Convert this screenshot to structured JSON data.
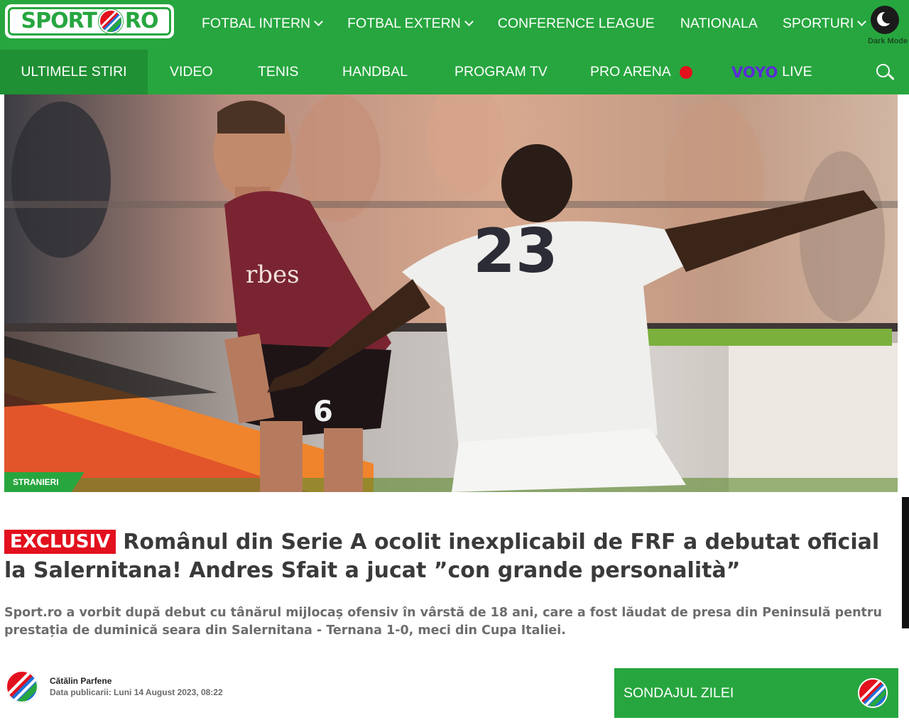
{
  "brand": {
    "logo_left": "SPORT",
    "logo_right": "RO",
    "colors": {
      "green": "#27a63f",
      "red": "#e3101d",
      "blue": "#1e6fd9",
      "voyo_purple": "#5b2bd8"
    }
  },
  "top_nav": {
    "items": [
      {
        "label": "FOTBAL INTERN",
        "dropdown": true
      },
      {
        "label": "FOTBAL EXTERN",
        "dropdown": true
      },
      {
        "label": "CONFERENCE LEAGUE",
        "dropdown": false
      },
      {
        "label": "NATIONALA",
        "dropdown": false
      },
      {
        "label": "SPORTURI",
        "dropdown": true
      }
    ],
    "dark_mode_label": "Dark Mode"
  },
  "sub_nav": {
    "items": [
      {
        "label": "ULTIMELE STIRI"
      },
      {
        "label": "VIDEO"
      },
      {
        "label": "TENIS"
      },
      {
        "label": "HANDBAL"
      },
      {
        "label": "PROGRAM TV"
      },
      {
        "label": "PRO ARENA"
      }
    ],
    "voyo_brand": "VOYO",
    "voyo_live": "LIVE",
    "search_icon": "search-icon"
  },
  "article": {
    "category": "STRANIERI",
    "badge": "EXCLUSIV",
    "title": "Românul din Serie A ocolit inexplicabil de FRF a debutat oficial la Salernitana! Andres Sfait a jucat ”con grande personalità”",
    "lead": "Sport.ro a vorbit după debut cu tânărul mijlocaș ofensiv în vârstă de 18 ani, care a fost lăudat de presa din Peninsulă pentru prestația de duminică seara din Salernitana - Ternana 1-0, meci din Cupa Italiei.",
    "author": "Cătălin Parfene",
    "published_label": "Data publicarii:",
    "published_value": "Luni 14 August 2023, 08:22",
    "hero_image": {
      "jersey_number_front": "6",
      "jersey_number_back": "23",
      "sponsor": "rbes"
    }
  },
  "poll": {
    "label": "SONDAJUL ZILEI"
  }
}
